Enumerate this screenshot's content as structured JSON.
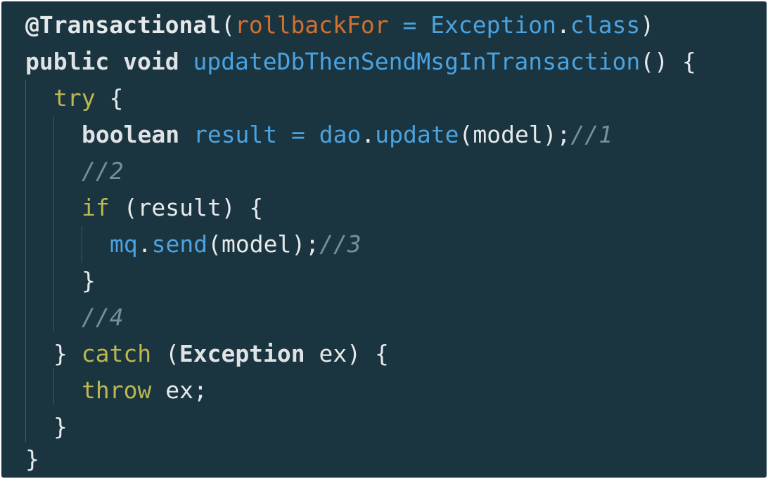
{
  "colors": {
    "background": "#1b3540",
    "annotation": "#e6e9ea",
    "keyword": "#dfe3e5",
    "control_keyword": "#bdb74f",
    "parameter": "#d2702f",
    "identifier": "#4aa3e0",
    "comment": "#7a8e96",
    "plain": "#e6e9ea"
  },
  "code": {
    "l1": {
      "annotation": "@Transactional",
      "open": "(",
      "param": "rollbackFor",
      "eq": " = ",
      "ident": "Exception",
      "dot": ".",
      "ident2": "class",
      "close": ")"
    },
    "l2": {
      "kw1": "public",
      "kw2": "void",
      "fn": "updateDbThenSendMsgInTransaction",
      "rest": "() {"
    },
    "l3": {
      "kw": "try",
      "rest": " {"
    },
    "l4": {
      "kw": "boolean",
      "ident": "result",
      "eq": " = ",
      "ident2": "dao",
      "dot": ".",
      "fn": "update",
      "rest": "(model);",
      "cmt": "//1"
    },
    "l5": {
      "cmt": "//2"
    },
    "l6": {
      "kw": "if",
      "rest": " (result) {"
    },
    "l7": {
      "ident": "mq",
      "dot": ".",
      "fn": "send",
      "rest": "(model);",
      "cmt": "//3"
    },
    "l8": {
      "rest": "}"
    },
    "l9": {
      "cmt": "//4"
    },
    "l10": {
      "pre": "} ",
      "kw": "catch",
      "open": " (",
      "type": "Exception",
      "rest": " ex) {"
    },
    "l11": {
      "kw": "throw",
      "rest": " ex;"
    },
    "l12": {
      "rest": "}"
    },
    "l13": {
      "rest": "}"
    }
  }
}
